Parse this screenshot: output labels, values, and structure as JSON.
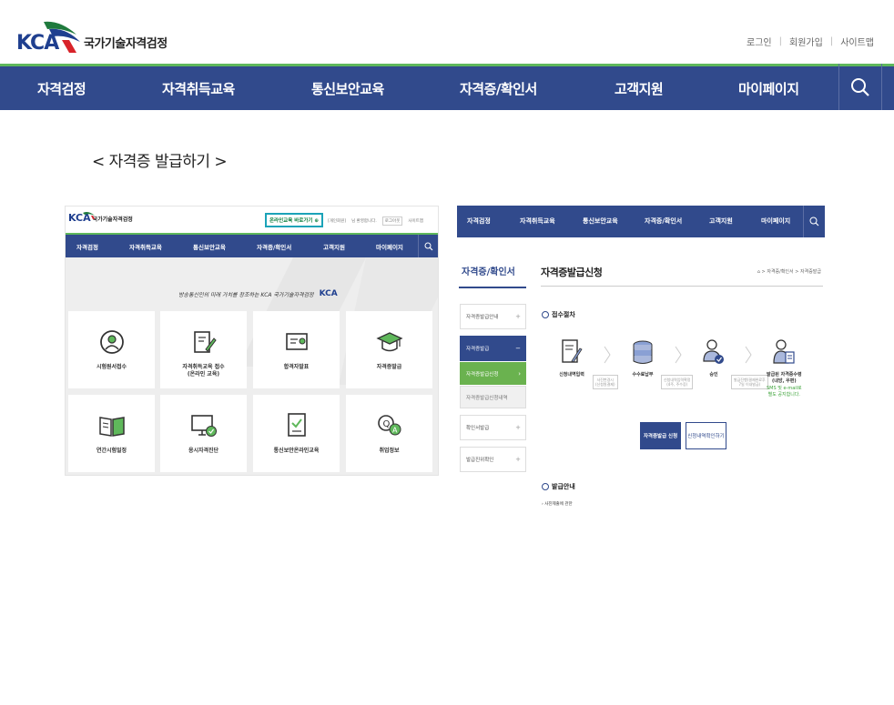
{
  "header": {
    "logo_text": "KCA",
    "logo_subtitle": "국가기술자격검정",
    "util_links": [
      "로그인",
      "회원가입",
      "사이트맵"
    ],
    "brand_color": "#314a8c",
    "accent_color": "#5fb85b"
  },
  "nav": {
    "items": [
      "자격검정",
      "자격취득교육",
      "통신보안교육",
      "자격증/확인서",
      "고객지원",
      "마이페이지"
    ],
    "search_icon": "search-icon"
  },
  "section_title": "< 자격증 발급하기 >",
  "left_shot": {
    "logo_text": "KCA",
    "logo_subtitle": "국가기술자격검정",
    "online_button": "온라인교육 바로가기 ⊕",
    "top_links": [
      "[개인회원]",
      "님 환영합니다.",
      "로그아웃",
      "사이트맵"
    ],
    "nav_items": [
      "자격검정",
      "자격취득교육",
      "통신보안교육",
      "자격증/확인서",
      "고객지원",
      "마이페이지"
    ],
    "slogan": "방송통신인의 미래 가치를 창조하는 KCA 국가기술자격검정",
    "slogan_logo": "KCA",
    "cards": [
      {
        "label": "시험원서접수",
        "icon": "person-icon"
      },
      {
        "label": "자격취득교육 접수\n(온라인 교육)",
        "icon": "edit-document-icon"
      },
      {
        "label": "합격자발표",
        "icon": "certificate-icon"
      },
      {
        "label": "자격증발급",
        "icon": "graduation-cap-icon"
      },
      {
        "label": "연간시험일정",
        "icon": "book-icon"
      },
      {
        "label": "응시자격진단",
        "icon": "monitor-check-icon"
      },
      {
        "label": "통신보안온라인교육",
        "icon": "document-check-icon"
      },
      {
        "label": "취업정보",
        "icon": "qa-icon"
      }
    ]
  },
  "right_shot": {
    "nav_items": [
      "자격검정",
      "자격취득교육",
      "통신보안교육",
      "자격증/확인서",
      "고객지원",
      "마이페이지"
    ],
    "side_title": "자격증/확인서",
    "side_items": [
      {
        "label": "자격증발급안내",
        "state": "normal"
      },
      {
        "label": "자격증발급",
        "state": "active"
      },
      {
        "label": "자격증발급신청",
        "state": "sub-active"
      },
      {
        "label": "자격증발급신청내역",
        "state": "sub"
      },
      {
        "label": "확인서발급",
        "state": "normal"
      },
      {
        "label": "발급진위확인",
        "state": "normal"
      }
    ],
    "page_title": "자격증발급신청",
    "breadcrumb": "⌂ > 자격증/확인서 > 자격증발급",
    "section1": "접수절차",
    "steps": [
      {
        "label": "신청내역입력",
        "minibox": "",
        "note": "",
        "icon": "document-pen-icon"
      },
      {
        "label": "",
        "minibox": "사진변경시\n(신청원결제)",
        "note": "",
        "icon": ""
      },
      {
        "label": "수수료납부",
        "minibox": "",
        "note": "",
        "icon": "coins-icon"
      },
      {
        "label": "",
        "minibox": "신청내역입력확정\n(4주, 주수증)",
        "note": "",
        "icon": ""
      },
      {
        "label": "승인",
        "minibox": "",
        "note": "",
        "icon": "user-check-icon"
      },
      {
        "label": "",
        "minibox": "발급진행(결제완료후\n7일 이내발급)",
        "note": "",
        "icon": ""
      },
      {
        "label": "발급된 자격증수령\n(내방, 우편)",
        "minibox": "",
        "note": "SMS 및 e-mail로\n별도 공지합니다.",
        "icon": "user-doc-icon"
      }
    ],
    "btn_apply": "자격증발급 신청",
    "btn_history": "신청내역확인하기",
    "section2": "발급안내",
    "small_text": "› 사진제출에 관한"
  }
}
